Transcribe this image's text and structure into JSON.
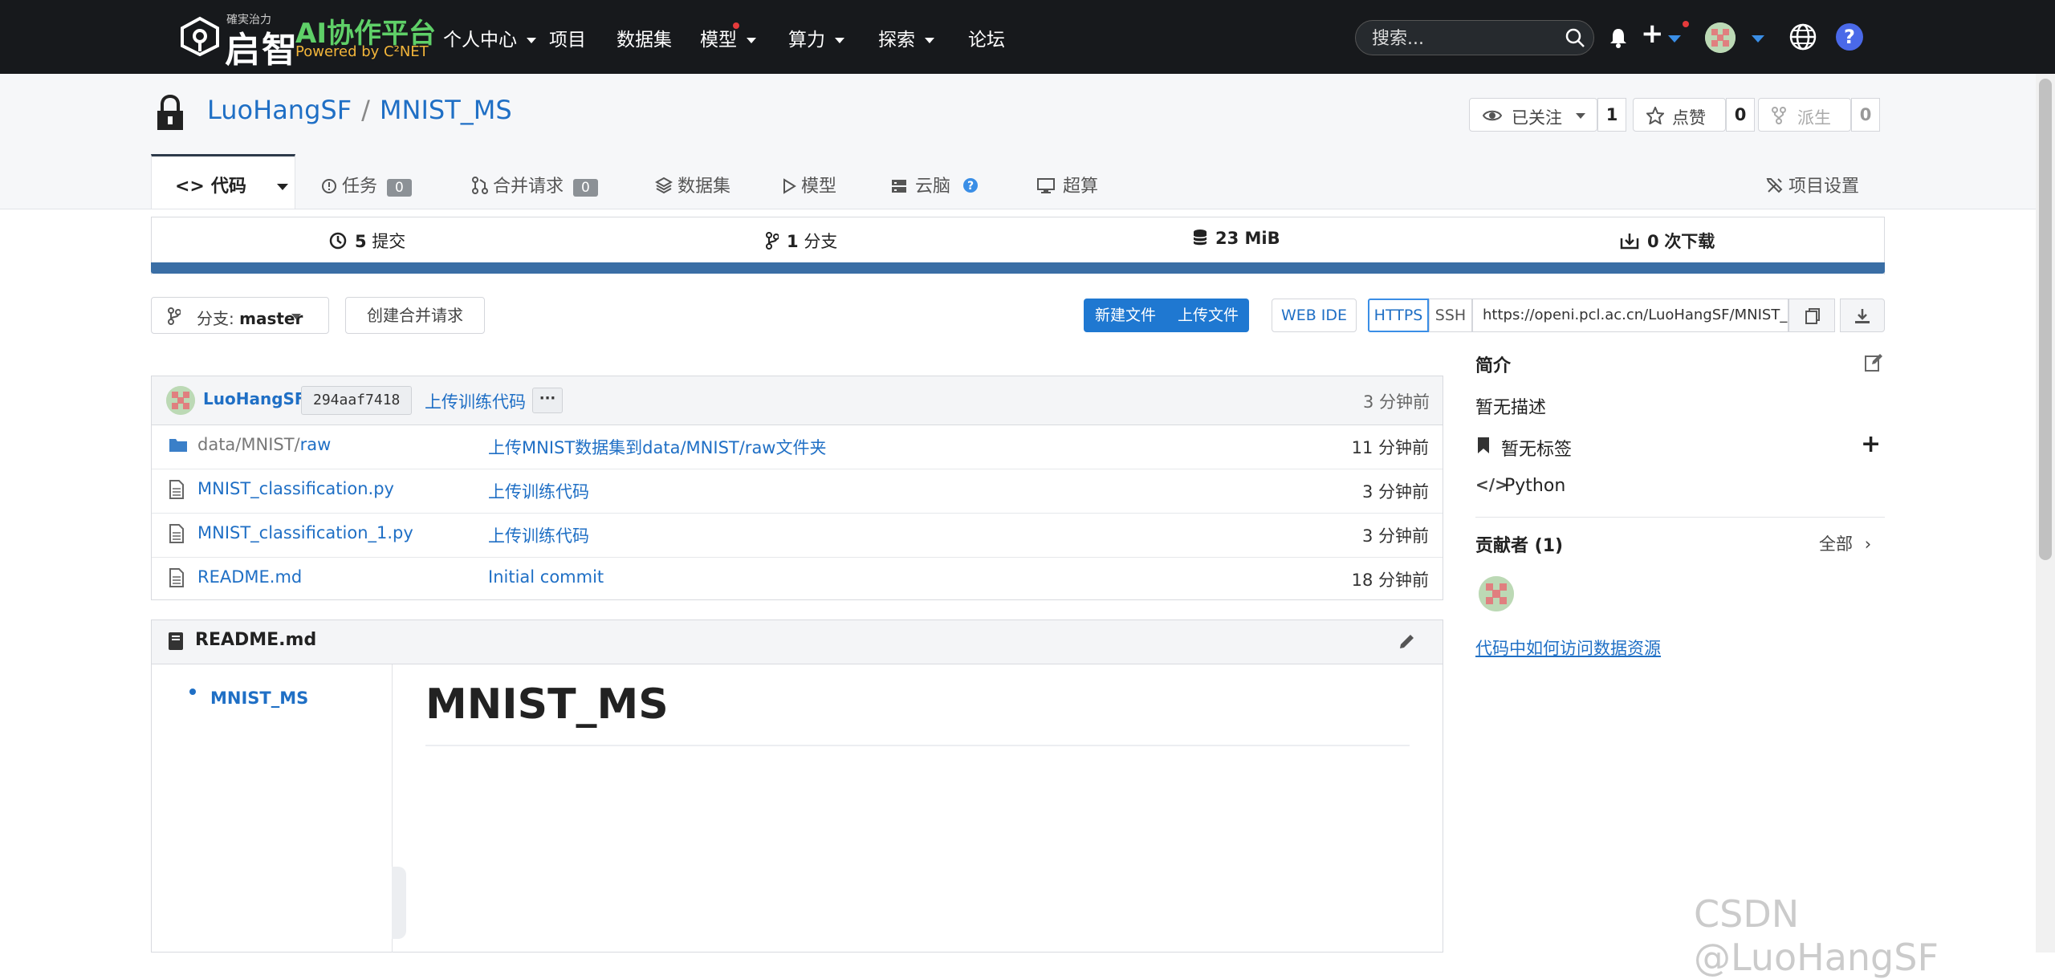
{
  "topnav": {
    "logo_cn": "启智",
    "logo_tag": "確実治力",
    "logo_ai": "AI协作平台",
    "logo_powered": "Powered by C²NET",
    "items": [
      "个人中心",
      "项目",
      "数据集",
      "模型",
      "算力",
      "探索",
      "论坛"
    ],
    "search_placeholder": "搜索..."
  },
  "repo": {
    "owner": "LuoHangSF",
    "sep": "/",
    "name": "MNIST_MS",
    "watch_label": "已关注",
    "watch_count": "1",
    "star_label": "点赞",
    "star_count": "0",
    "fork_label": "派生",
    "fork_count": "0"
  },
  "tabs": {
    "code": "代码",
    "issues": "任务",
    "issues_count": "0",
    "pulls": "合并请求",
    "pulls_count": "0",
    "datasets": "数据集",
    "models": "模型",
    "cloudbrain": "云脑",
    "supercompute": "超算",
    "settings": "项目设置"
  },
  "stats": {
    "commits_num": "5",
    "commits_label": "提交",
    "branches_num": "1",
    "branches_label": "分支",
    "size": "23 MiB",
    "downloads_num": "0",
    "downloads_label": "次下载"
  },
  "toolbar": {
    "branch_prefix": "分支:",
    "branch_name": "master",
    "create_pr": "创建合并请求",
    "new_file": "新建文件",
    "upload_file": "上传文件",
    "web_ide": "WEB IDE",
    "https": "HTTPS",
    "ssh": "SSH",
    "clone_url": "https://openi.pcl.ac.cn/LuoHangSF/MNIST_MS.git"
  },
  "commit": {
    "author": "LuoHangSF",
    "sha": "294aaf7418",
    "message": "上传训练代码",
    "more": "···",
    "time": "3 分钟前"
  },
  "files": [
    {
      "prefix": "data/MNIST/",
      "name": "raw",
      "message": "上传MNIST数据集到data/MNIST/raw文件夹",
      "time": "11 分钟前",
      "type": "folder"
    },
    {
      "prefix": "",
      "name": "MNIST_classification.py",
      "message": "上传训练代码",
      "time": "3 分钟前",
      "type": "file"
    },
    {
      "prefix": "",
      "name": "MNIST_classification_1.py",
      "message": "上传训练代码",
      "time": "3 分钟前",
      "type": "file"
    },
    {
      "prefix": "",
      "name": "README.md",
      "message": "Initial commit",
      "time": "18 分钟前",
      "type": "file"
    }
  ],
  "readme": {
    "filename": "README.md",
    "toc_item": "MNIST_MS",
    "title": "MNIST_MS"
  },
  "sidebar": {
    "intro_title": "简介",
    "intro_text": "暂无描述",
    "no_tags": "暂无标签",
    "add": "+",
    "language": "Python",
    "contributors_title": "贡献者 (1)",
    "all": "全部",
    "data_link": "代码中如何访问数据资源"
  },
  "watermark": "CSDN @LuoHangSF"
}
